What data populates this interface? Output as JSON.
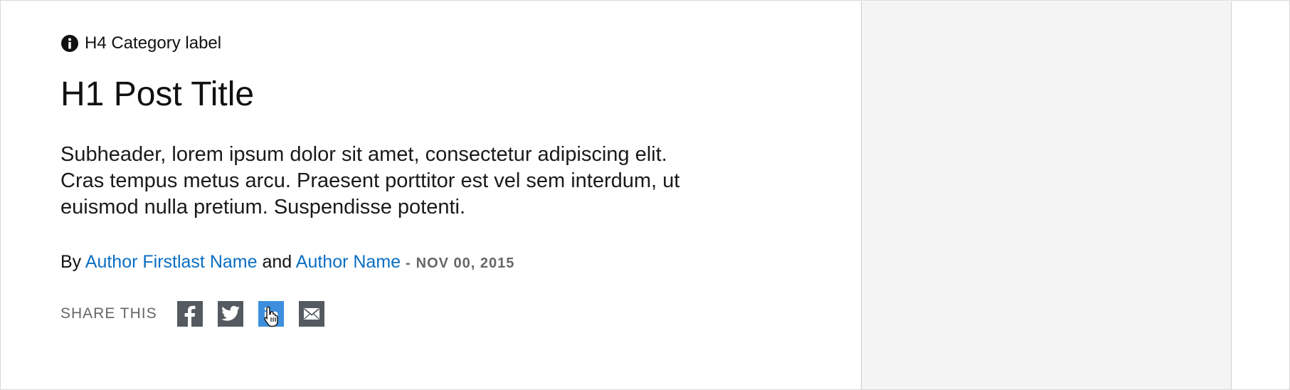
{
  "post": {
    "category": "H4 Category label",
    "title": "H1 Post Title",
    "subheader": "Subheader, lorem ipsum dolor sit amet, consectetur adipiscing elit. Cras tempus metus arcu. Praesent porttitor est vel sem interdum, ut euismod nulla pretium. Suspendisse potenti.",
    "byline": {
      "by": "By",
      "author1": "Author Firstlast Name",
      "and": "and",
      "author2": "Author Name",
      "separator": "-",
      "date": "NOV 00, 2015"
    }
  },
  "share": {
    "label": "SHARE THIS",
    "buttons": [
      {
        "icon": "facebook-icon",
        "state": "default"
      },
      {
        "icon": "twitter-icon",
        "state": "default"
      },
      {
        "icon": "linkedin-icon",
        "state": "hover"
      },
      {
        "icon": "email-icon",
        "state": "default"
      }
    ]
  },
  "colors": {
    "link": "#0a6ec2",
    "share_button": "#555a60",
    "share_button_active": "#3d8fdd",
    "side_panel": "#f4f4f4",
    "muted_text": "#666666"
  }
}
